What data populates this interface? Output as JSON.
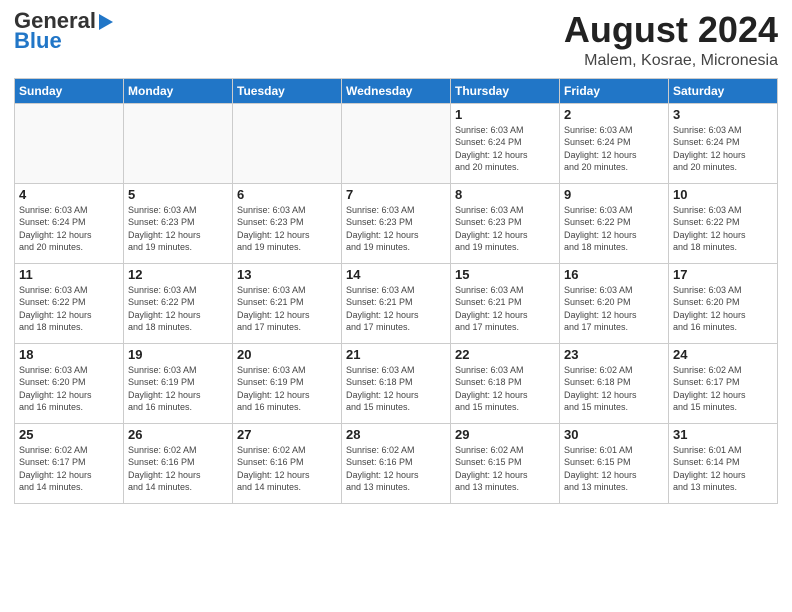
{
  "header": {
    "logo_line1": "General",
    "logo_line2": "Blue",
    "month_year": "August 2024",
    "location": "Malem, Kosrae, Micronesia"
  },
  "days_of_week": [
    "Sunday",
    "Monday",
    "Tuesday",
    "Wednesday",
    "Thursday",
    "Friday",
    "Saturday"
  ],
  "weeks": [
    [
      {
        "day": "",
        "info": ""
      },
      {
        "day": "",
        "info": ""
      },
      {
        "day": "",
        "info": ""
      },
      {
        "day": "",
        "info": ""
      },
      {
        "day": "1",
        "info": "Sunrise: 6:03 AM\nSunset: 6:24 PM\nDaylight: 12 hours\nand 20 minutes."
      },
      {
        "day": "2",
        "info": "Sunrise: 6:03 AM\nSunset: 6:24 PM\nDaylight: 12 hours\nand 20 minutes."
      },
      {
        "day": "3",
        "info": "Sunrise: 6:03 AM\nSunset: 6:24 PM\nDaylight: 12 hours\nand 20 minutes."
      }
    ],
    [
      {
        "day": "4",
        "info": "Sunrise: 6:03 AM\nSunset: 6:24 PM\nDaylight: 12 hours\nand 20 minutes."
      },
      {
        "day": "5",
        "info": "Sunrise: 6:03 AM\nSunset: 6:23 PM\nDaylight: 12 hours\nand 19 minutes."
      },
      {
        "day": "6",
        "info": "Sunrise: 6:03 AM\nSunset: 6:23 PM\nDaylight: 12 hours\nand 19 minutes."
      },
      {
        "day": "7",
        "info": "Sunrise: 6:03 AM\nSunset: 6:23 PM\nDaylight: 12 hours\nand 19 minutes."
      },
      {
        "day": "8",
        "info": "Sunrise: 6:03 AM\nSunset: 6:23 PM\nDaylight: 12 hours\nand 19 minutes."
      },
      {
        "day": "9",
        "info": "Sunrise: 6:03 AM\nSunset: 6:22 PM\nDaylight: 12 hours\nand 18 minutes."
      },
      {
        "day": "10",
        "info": "Sunrise: 6:03 AM\nSunset: 6:22 PM\nDaylight: 12 hours\nand 18 minutes."
      }
    ],
    [
      {
        "day": "11",
        "info": "Sunrise: 6:03 AM\nSunset: 6:22 PM\nDaylight: 12 hours\nand 18 minutes."
      },
      {
        "day": "12",
        "info": "Sunrise: 6:03 AM\nSunset: 6:22 PM\nDaylight: 12 hours\nand 18 minutes."
      },
      {
        "day": "13",
        "info": "Sunrise: 6:03 AM\nSunset: 6:21 PM\nDaylight: 12 hours\nand 17 minutes."
      },
      {
        "day": "14",
        "info": "Sunrise: 6:03 AM\nSunset: 6:21 PM\nDaylight: 12 hours\nand 17 minutes."
      },
      {
        "day": "15",
        "info": "Sunrise: 6:03 AM\nSunset: 6:21 PM\nDaylight: 12 hours\nand 17 minutes."
      },
      {
        "day": "16",
        "info": "Sunrise: 6:03 AM\nSunset: 6:20 PM\nDaylight: 12 hours\nand 17 minutes."
      },
      {
        "day": "17",
        "info": "Sunrise: 6:03 AM\nSunset: 6:20 PM\nDaylight: 12 hours\nand 16 minutes."
      }
    ],
    [
      {
        "day": "18",
        "info": "Sunrise: 6:03 AM\nSunset: 6:20 PM\nDaylight: 12 hours\nand 16 minutes."
      },
      {
        "day": "19",
        "info": "Sunrise: 6:03 AM\nSunset: 6:19 PM\nDaylight: 12 hours\nand 16 minutes."
      },
      {
        "day": "20",
        "info": "Sunrise: 6:03 AM\nSunset: 6:19 PM\nDaylight: 12 hours\nand 16 minutes."
      },
      {
        "day": "21",
        "info": "Sunrise: 6:03 AM\nSunset: 6:18 PM\nDaylight: 12 hours\nand 15 minutes."
      },
      {
        "day": "22",
        "info": "Sunrise: 6:03 AM\nSunset: 6:18 PM\nDaylight: 12 hours\nand 15 minutes."
      },
      {
        "day": "23",
        "info": "Sunrise: 6:02 AM\nSunset: 6:18 PM\nDaylight: 12 hours\nand 15 minutes."
      },
      {
        "day": "24",
        "info": "Sunrise: 6:02 AM\nSunset: 6:17 PM\nDaylight: 12 hours\nand 15 minutes."
      }
    ],
    [
      {
        "day": "25",
        "info": "Sunrise: 6:02 AM\nSunset: 6:17 PM\nDaylight: 12 hours\nand 14 minutes."
      },
      {
        "day": "26",
        "info": "Sunrise: 6:02 AM\nSunset: 6:16 PM\nDaylight: 12 hours\nand 14 minutes."
      },
      {
        "day": "27",
        "info": "Sunrise: 6:02 AM\nSunset: 6:16 PM\nDaylight: 12 hours\nand 14 minutes."
      },
      {
        "day": "28",
        "info": "Sunrise: 6:02 AM\nSunset: 6:16 PM\nDaylight: 12 hours\nand 13 minutes."
      },
      {
        "day": "29",
        "info": "Sunrise: 6:02 AM\nSunset: 6:15 PM\nDaylight: 12 hours\nand 13 minutes."
      },
      {
        "day": "30",
        "info": "Sunrise: 6:01 AM\nSunset: 6:15 PM\nDaylight: 12 hours\nand 13 minutes."
      },
      {
        "day": "31",
        "info": "Sunrise: 6:01 AM\nSunset: 6:14 PM\nDaylight: 12 hours\nand 13 minutes."
      }
    ]
  ]
}
